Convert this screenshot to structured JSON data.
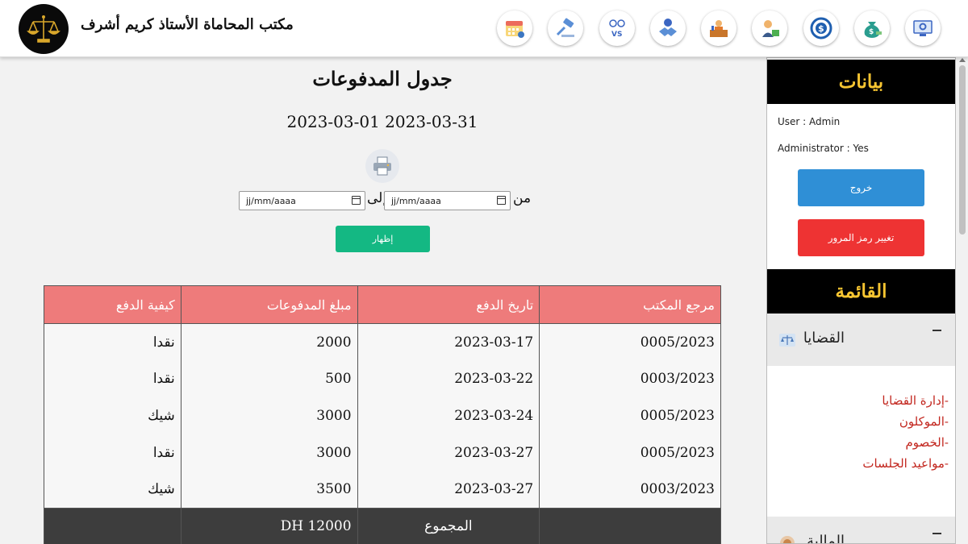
{
  "header": {
    "brand": "مكتب المحاماة الأستاذ كريم أشرف",
    "nav_icons": [
      "monitor-settings-icon",
      "money-bag-icon",
      "dollar-coin-icon",
      "accountant-icon",
      "lawyer-desk-icon",
      "agreement-icon",
      "versus-icon",
      "gavel-icon",
      "calendar-icon"
    ]
  },
  "main": {
    "title": "جدول المدفوعات",
    "date_range": "2023-03-01 2023-03-31",
    "filter": {
      "from_label": "من",
      "to_label": "إلى",
      "from_placeholder": "jj/mm/aaaa",
      "to_placeholder": "jj/mm/aaaa"
    },
    "show_button": "إظهار",
    "table": {
      "headers": [
        "مرجع المكتب",
        "تاريخ الدفع",
        "مبلغ المدفوعات",
        "كيفية الدفع"
      ],
      "rows": [
        [
          "0005/2023",
          "2023-03-17",
          "2000",
          "نقدا"
        ],
        [
          "0003/2023",
          "2023-03-22",
          "500",
          "نقدا"
        ],
        [
          "0005/2023",
          "2023-03-24",
          "3000",
          "شيك"
        ],
        [
          "0005/2023",
          "2023-03-27",
          "3000",
          "نقدا"
        ],
        [
          "0003/2023",
          "2023-03-27",
          "3500",
          "شيك"
        ]
      ],
      "total_label": "المجموع",
      "total_value": "12000 DH"
    }
  },
  "sidebar": {
    "data_title": "بيانات",
    "user": "User : Admin",
    "admin": "Administrator : Yes",
    "logout": "خروج",
    "change_password": "تغيير رمز المرور",
    "menu_title": "القائمة",
    "cases": {
      "label": "القضايا",
      "items": [
        "-إدارة القضايا",
        "-الموكلون",
        "-الخصوم",
        "-مواعيد الجلسات"
      ]
    },
    "finance": {
      "label": "المالية"
    }
  },
  "colors": {
    "table_header": "#ee7b7b",
    "total_row": "#3d3d3d",
    "show_button": "#14b883",
    "logout_button": "#2f8fd6",
    "password_button": "#ee3333",
    "sidebar_heading": "#f7c531",
    "submenu_link": "#c2261e"
  }
}
